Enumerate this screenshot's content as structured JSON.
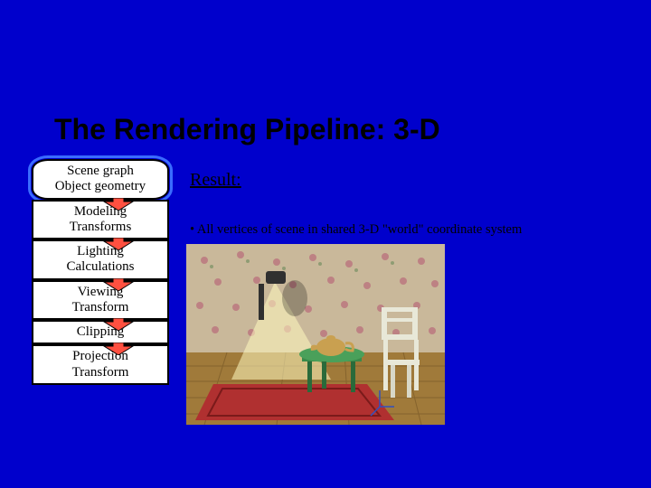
{
  "title": "The Rendering Pipeline: 3-D",
  "result_heading": "Result:",
  "bullet": "• All vertices of scene in shared 3-D \"world\" coordinate system",
  "stages": [
    {
      "line1": "Scene graph",
      "line2": "Object geometry"
    },
    {
      "line1": "Modeling",
      "line2": "Transforms"
    },
    {
      "line1": "Lighting",
      "line2": "Calculations"
    },
    {
      "line1": "Viewing",
      "line2": "Transform"
    },
    {
      "line1": "Clipping",
      "line2": ""
    },
    {
      "line1": "Projection",
      "line2": "Transform"
    }
  ],
  "highlighted_stage_index": 0,
  "scene_image": {
    "description": "rendered 3-D room with floral wallpaper, wooden floor, a spotlight casting a cone of light, green table with teapot, white chair, red rug",
    "colors": {
      "wallpaper_base": "#c9b89a",
      "wallpaper_flower": "#b86a7a",
      "floor": "#a07a3a",
      "rug": "#b03030",
      "table": "#3a8a4a",
      "teapot": "#c9a050",
      "chair": "#e8e8d8",
      "spotlight_body": "#303030",
      "light_cone": "#fff9c0"
    }
  }
}
